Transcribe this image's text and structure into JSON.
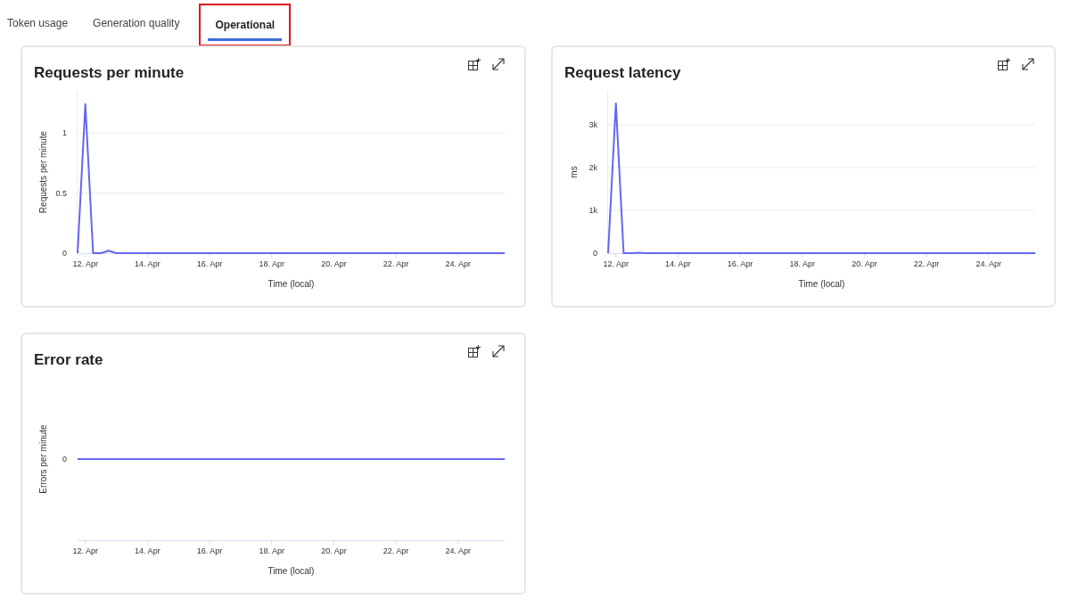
{
  "tabs": [
    {
      "label": "Token usage",
      "selected": false,
      "highlighted": false
    },
    {
      "label": "Generation quality",
      "selected": false,
      "highlighted": false
    },
    {
      "label": "Operational",
      "selected": true,
      "highlighted": true
    }
  ],
  "cards": [
    {
      "title": "Requests per minute",
      "chart_data": {
        "type": "line",
        "xlabel": "Time (local)",
        "ylabel": "Requests per minute",
        "categories": [
          null,
          "12. Apr",
          null,
          null,
          null,
          null,
          null,
          null,
          null,
          "14. Apr",
          null,
          null,
          null,
          null,
          null,
          null,
          null,
          "16. Apr",
          null,
          null,
          null,
          null,
          null,
          null,
          null,
          "18. Apr",
          null,
          null,
          null,
          null,
          null,
          null,
          null,
          "20. Apr",
          null,
          null,
          null,
          null,
          null,
          null,
          null,
          "22. Apr",
          null,
          null,
          null,
          null,
          null,
          null,
          null,
          "24. Apr",
          null,
          null,
          null,
          null,
          null,
          null
        ],
        "series": [
          {
            "color": "#6466f1",
            "values": [
              0,
              1.24,
              0,
              0,
              0.02,
              0,
              0,
              0,
              0,
              0,
              0,
              0,
              0,
              0,
              0,
              0,
              0,
              0,
              0,
              0,
              0,
              0,
              0,
              0,
              0,
              0,
              0,
              0,
              0,
              0,
              0,
              0,
              0,
              0,
              0,
              0,
              0,
              0,
              0,
              0,
              0,
              0,
              0,
              0,
              0,
              0,
              0,
              0,
              0,
              0,
              0,
              0,
              0,
              0,
              0,
              0
            ]
          }
        ],
        "grid": true,
        "ylim": [
          0,
          1.35
        ],
        "yticks": [
          0,
          0.5,
          1
        ]
      }
    },
    {
      "title": "Request latency",
      "chart_data": {
        "type": "line",
        "xlabel": "Time (local)",
        "ylabel": "ms",
        "categories": [
          null,
          "12. Apr",
          null,
          null,
          null,
          null,
          null,
          null,
          null,
          "14. Apr",
          null,
          null,
          null,
          null,
          null,
          null,
          null,
          "16. Apr",
          null,
          null,
          null,
          null,
          null,
          null,
          null,
          "18. Apr",
          null,
          null,
          null,
          null,
          null,
          null,
          null,
          "20. Apr",
          null,
          null,
          null,
          null,
          null,
          null,
          null,
          "22. Apr",
          null,
          null,
          null,
          null,
          null,
          null,
          null,
          "24. Apr",
          null,
          null,
          null,
          null,
          null,
          null
        ],
        "series": [
          {
            "color": "#6466f1",
            "values": [
              0,
              3500,
              0,
              0,
              10,
              0,
              0,
              0,
              0,
              0,
              0,
              0,
              0,
              0,
              0,
              0,
              0,
              0,
              0,
              0,
              0,
              0,
              0,
              0,
              0,
              0,
              0,
              0,
              0,
              0,
              0,
              0,
              0,
              0,
              0,
              0,
              0,
              0,
              0,
              0,
              0,
              0,
              0,
              0,
              0,
              0,
              0,
              0,
              0,
              0,
              0,
              0,
              0,
              0,
              0,
              0
            ]
          }
        ],
        "grid": true,
        "ylim": [
          0,
          3790
        ],
        "yticks": [
          0,
          {
            "value": 1000,
            "label": "1k"
          },
          {
            "value": 2000,
            "label": "2k"
          },
          {
            "value": 3000,
            "label": "3k"
          }
        ]
      }
    },
    {
      "title": "Error rate",
      "plot": {
        "xlabel": "Time (local)",
        "ylabel": "Errors per minute",
        "y_label": "0",
        "x_labels": [
          "12. Apr",
          "14. Apr",
          "16. Apr",
          "18. Apr",
          "20. Apr",
          "22. Apr",
          "24. Apr"
        ]
      }
    }
  ]
}
